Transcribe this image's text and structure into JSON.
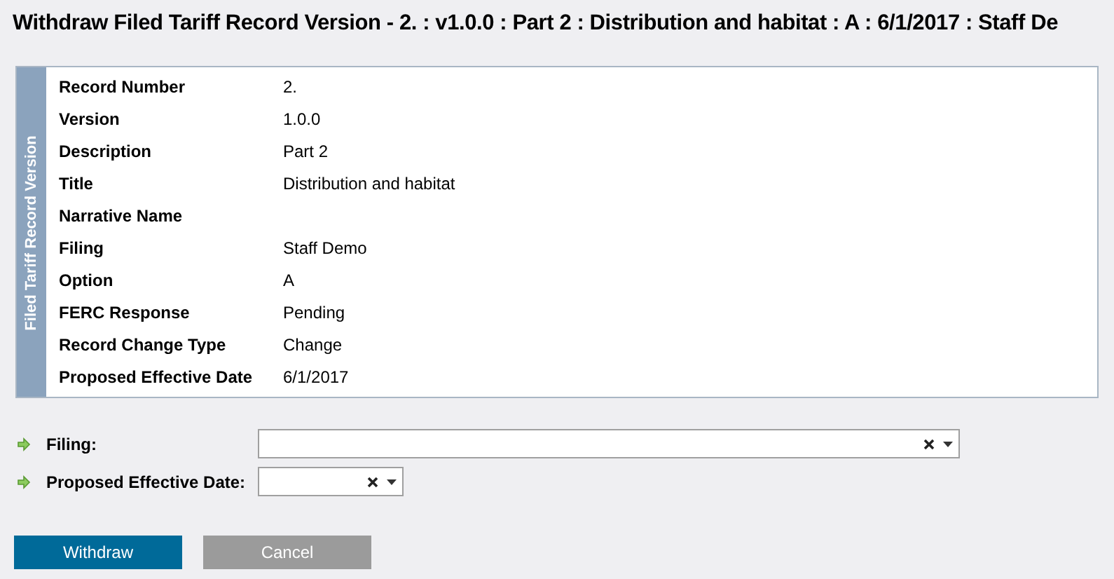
{
  "title": "Withdraw Filed Tariff Record Version - 2. : v1.0.0 : Part 2 : Distribution and habitat : A : 6/1/2017 : Staff De",
  "panel": {
    "side_label": "Filed Tariff Record Version",
    "rows": [
      {
        "label": "Record Number",
        "value": "2."
      },
      {
        "label": "Version",
        "value": "1.0.0"
      },
      {
        "label": "Description",
        "value": "Part 2"
      },
      {
        "label": "Title",
        "value": "Distribution and habitat"
      },
      {
        "label": "Narrative Name"
      },
      {
        "label": "Filing",
        "value": "Staff Demo"
      },
      {
        "label": "Option",
        "value": "A"
      },
      {
        "label": "FERC Response",
        "value": "Pending"
      },
      {
        "label": "Record Change Type",
        "value": "Change"
      },
      {
        "label": "Proposed Effective Date",
        "value": "6/1/2017"
      }
    ]
  },
  "fields": [
    {
      "label": "Filing:",
      "kind": "wide"
    },
    {
      "label": "Proposed Effective Date:",
      "kind": "narrow"
    }
  ],
  "buttons": [
    {
      "label": "Withdraw",
      "kind": "primary"
    },
    {
      "label": "Cancel",
      "kind": "secondary"
    }
  ]
}
